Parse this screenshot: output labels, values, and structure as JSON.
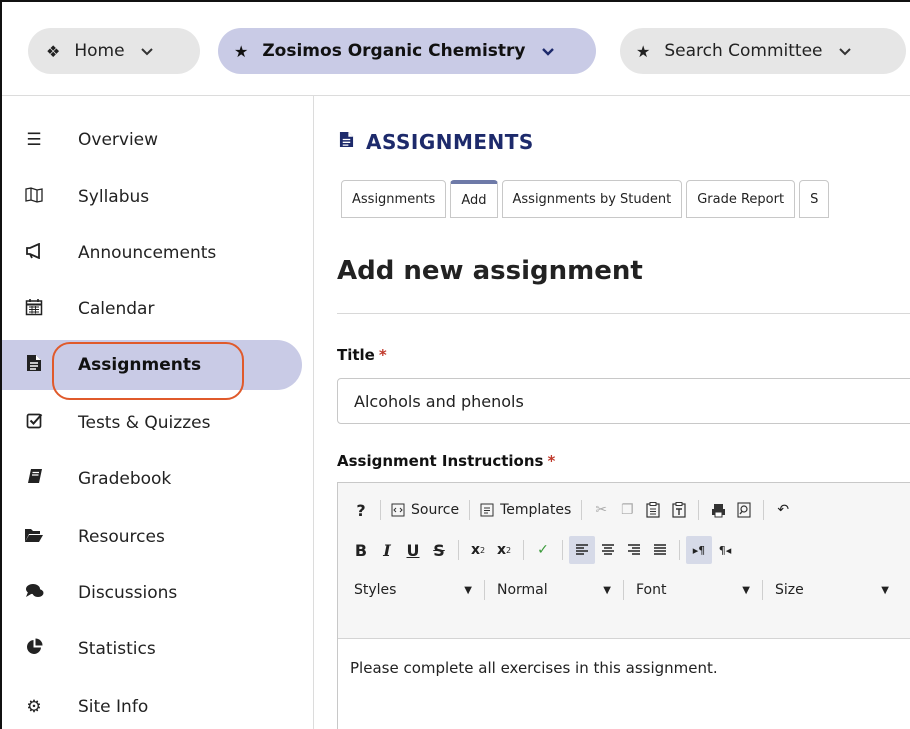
{
  "topbar": {
    "home": {
      "icon": "home-icon",
      "label": "Home"
    },
    "site": {
      "icon": "star-icon",
      "label": "Zosimos Organic Chemistry"
    },
    "search": {
      "icon": "star-icon",
      "label": "Search Committee"
    }
  },
  "sidebar": {
    "items": [
      {
        "icon": "list-icon",
        "label": "Overview"
      },
      {
        "icon": "map-icon",
        "label": "Syllabus"
      },
      {
        "icon": "megaphone-icon",
        "label": "Announcements"
      },
      {
        "icon": "calendar-icon",
        "label": "Calendar"
      },
      {
        "icon": "file-icon",
        "label": "Assignments",
        "active": true
      },
      {
        "icon": "checkbox-icon",
        "label": "Tests & Quizzes"
      },
      {
        "icon": "book-icon",
        "label": "Gradebook"
      },
      {
        "icon": "folder-icon",
        "label": "Resources"
      },
      {
        "icon": "chat-icon",
        "label": "Discussions"
      },
      {
        "icon": "pie-chart-icon",
        "label": "Statistics"
      },
      {
        "icon": "gear-icon",
        "label": "Site Info"
      }
    ]
  },
  "main": {
    "tool_title": "ASSIGNMENTS",
    "tabs": [
      {
        "label": "Assignments"
      },
      {
        "label": "Add",
        "active": true
      },
      {
        "label": "Assignments by Student"
      },
      {
        "label": "Grade Report"
      },
      {
        "label": "S"
      }
    ],
    "heading": "Add new assignment",
    "title_label": "Title",
    "required_mark": "*",
    "title_value": "Alcohols and phenols",
    "instructions_label": "Assignment Instructions",
    "editor": {
      "help": "?",
      "source": "Source",
      "templates": "Templates",
      "styles": "Styles",
      "format": "Normal",
      "font": "Font",
      "size": "Size",
      "body_text": "Please complete all exercises in this assignment."
    }
  },
  "colors": {
    "accent_pill": "#c9cbe6",
    "title_blue": "#1d2a6b",
    "highlight": "#e05a2b",
    "required": "#c0392b"
  }
}
